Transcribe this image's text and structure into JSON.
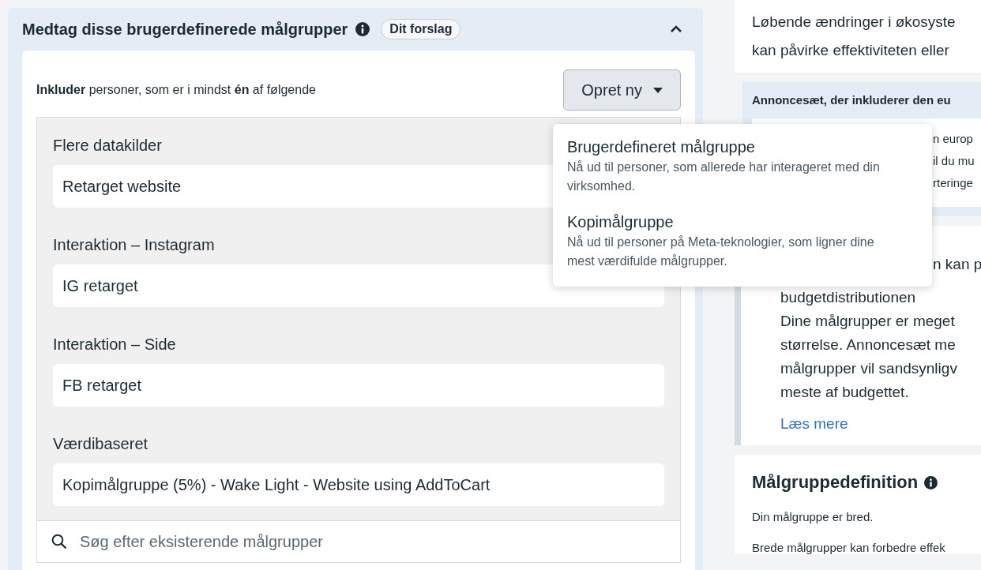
{
  "section": {
    "title": "Medtag disse brugerdefinerede målgrupper",
    "badge": "Dit forslag",
    "expanded": true,
    "include_text": "**Inkluder** personer, som er i mindst **én** af følgende",
    "create_button": "Opret ny",
    "groups": [
      {
        "label": "Flere datakilder",
        "items": [
          "Retarget website"
        ]
      },
      {
        "label": "Interaktion – Instagram",
        "items": [
          "IG retarget"
        ]
      },
      {
        "label": "Interaktion – Side",
        "items": [
          "FB retarget"
        ]
      },
      {
        "label": "Værdibaseret",
        "items": [
          "Kopimålgruppe (5%) - Wake Light - Website using AddToCart"
        ]
      }
    ],
    "search": {
      "placeholder": "Søg efter eksisterende målgrupper"
    }
  },
  "dropdown": {
    "items": [
      {
        "title": "Brugerdefineret målgruppe",
        "description": "Nå ud til personer, som allerede har interageret med din virksomhed."
      },
      {
        "title": "Kopimålgruppe",
        "description": "Nå ud til personer på Meta-teknologier, som ligner dine mest værdifulde målgrupper."
      }
    ]
  },
  "right_panel": {
    "intro_lines": [
      "Løbende ændringer i økosyste",
      "kan påvirke effektiviteten eller"
    ],
    "notice": {
      "title": "Annoncesæt, der inkluderer den eu",
      "lines": [
        "n europ",
        "il du mu",
        "rteringe"
      ]
    },
    "warning": {
      "lines": [
        "n kan p",
        "budgetdistributionen",
        "Dine målgrupper er meget",
        "størrelse. Annoncesæt me",
        "målgrupper vil sandsynligv",
        "meste af budgettet."
      ],
      "link": "Læs mere"
    },
    "definition": {
      "title": "Målgruppedefinition",
      "lines": [
        "Din målgruppe er bred.",
        "Brede målgrupper kan forbedre effek"
      ]
    }
  }
}
